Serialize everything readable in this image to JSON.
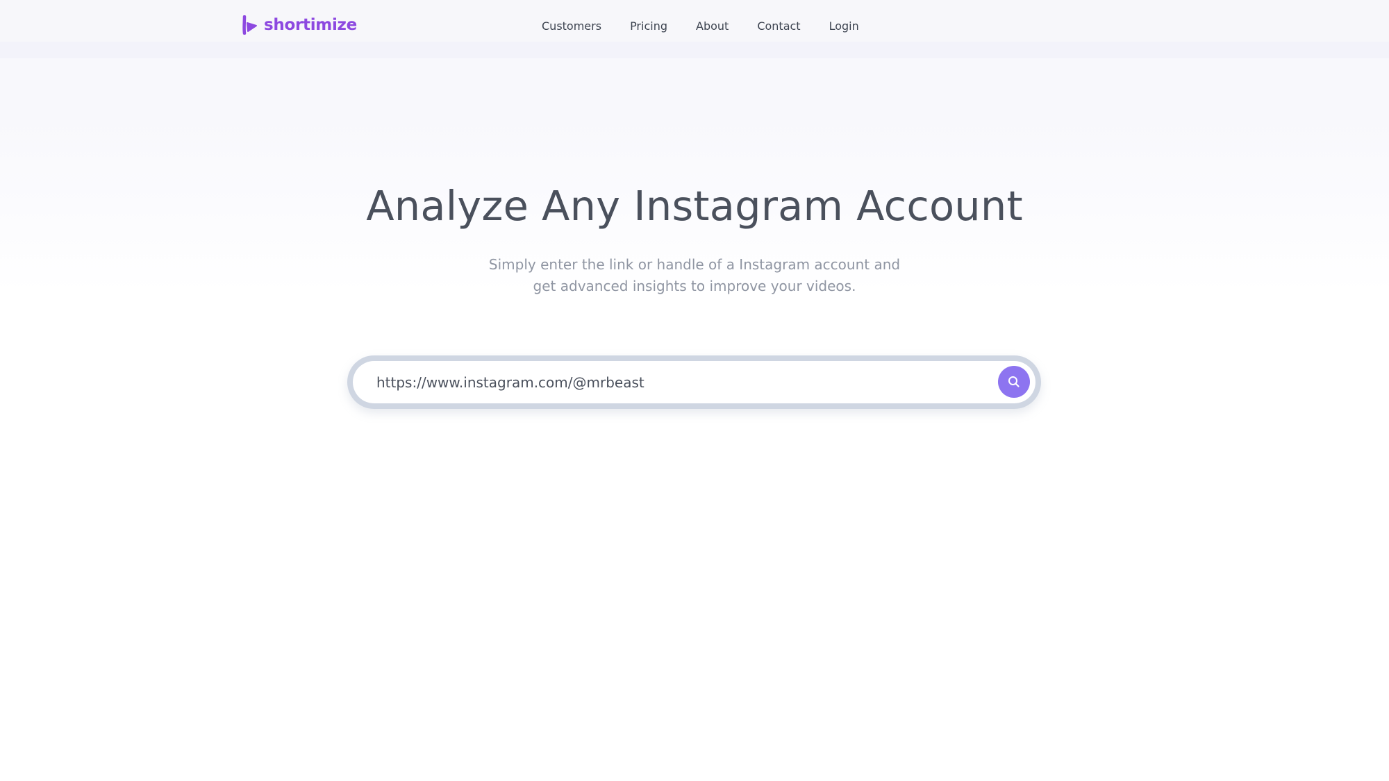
{
  "brand": {
    "name": "shortimize",
    "color": "#8d49e0"
  },
  "nav": {
    "items": [
      {
        "label": "Customers",
        "icon": ""
      },
      {
        "label": "Pricing",
        "icon": ""
      },
      {
        "label": "About",
        "icon": ""
      },
      {
        "label": "Contact",
        "icon": ""
      },
      {
        "label": "Login",
        "icon": ""
      }
    ]
  },
  "hero": {
    "title": "Analyze Any Instagram Account",
    "subtitle_line1": "Simply enter the link or handle of a Instagram account and",
    "subtitle_line2": "get advanced insights to improve your videos."
  },
  "search": {
    "value": "https://www.instagram.com/@mrbeast",
    "button_icon": "search-icon",
    "button_color": "#8d74f0"
  }
}
